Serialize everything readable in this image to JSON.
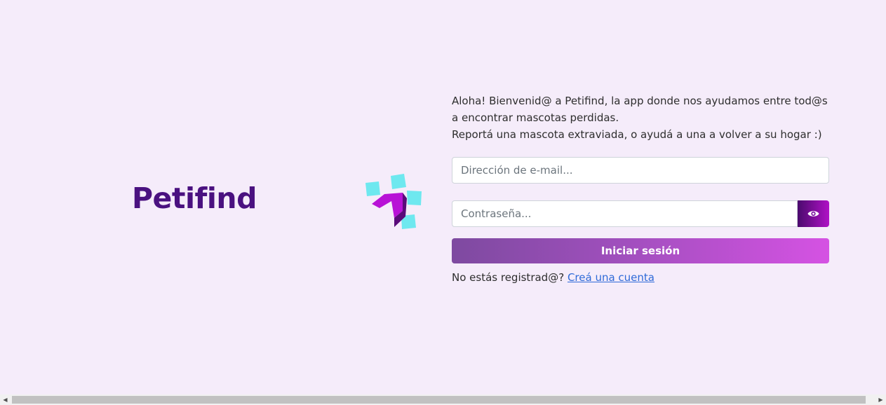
{
  "brand": {
    "name": "Petifind"
  },
  "intro": {
    "line1": "Aloha! Bienvenid@ a Petifind, la app donde nos ayudamos entre tod@s a encontrar mascotas perdidas.",
    "line2": "Reportá una mascota extraviada, o ayudá a una a volver a su hogar :)"
  },
  "login_form": {
    "email_placeholder": "Dirección de e-mail...",
    "email_value": "",
    "password_placeholder": "Contraseña...",
    "password_value": "",
    "show_password_icon": "eye-icon",
    "submit_label": "Iniciar sesión",
    "register_prompt": "No estás registrad@?",
    "register_link": "Creá una cuenta"
  },
  "colors": {
    "background": "#f5ecfa",
    "brand": "#4a1180",
    "button_gradient_start": "#7e4aa0",
    "button_gradient_end": "#d552e3",
    "link": "#2e6ad8",
    "logo_cyan": "#6ee8ef",
    "logo_magenta": "#b812d6"
  },
  "scrollbar": {
    "left_arrow_icon": "scroll-left-arrow-icon",
    "right_arrow_icon": "scroll-right-arrow-icon"
  }
}
